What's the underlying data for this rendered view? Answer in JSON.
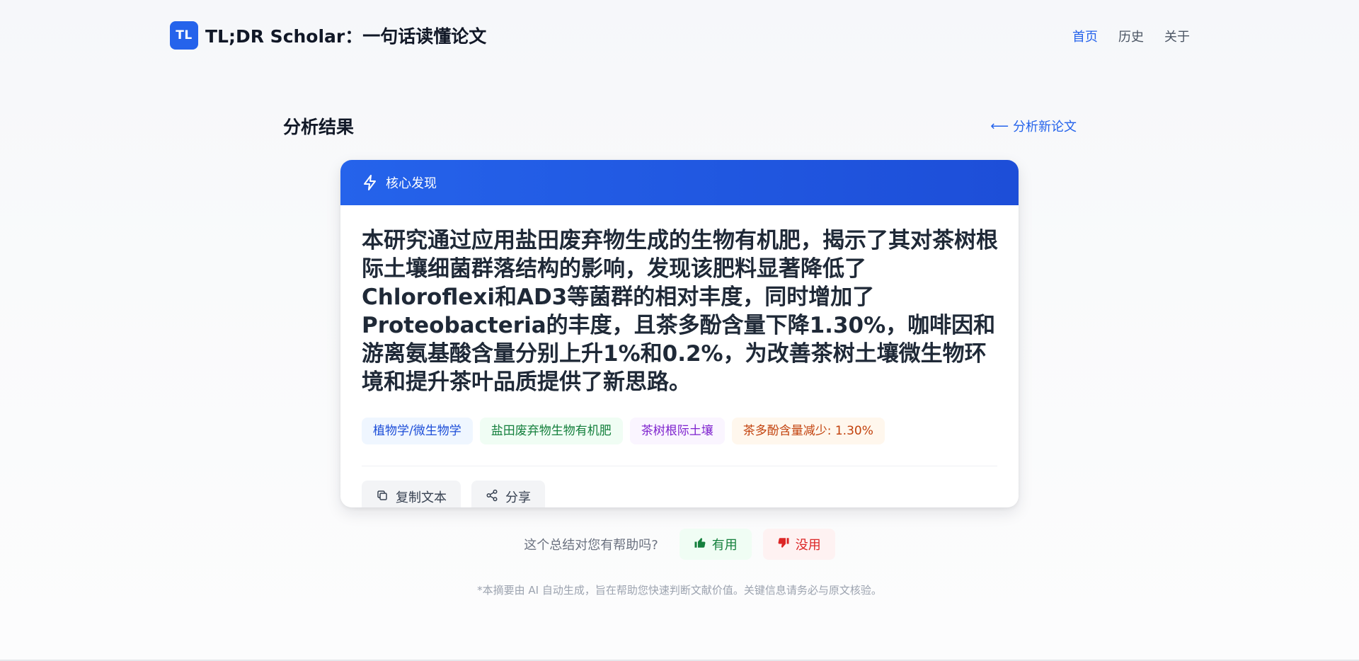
{
  "header": {
    "logo_badge": "TL",
    "title": "TL;DR Scholar：一句话读懂论文",
    "nav": [
      "首页",
      "历史",
      "关于"
    ]
  },
  "section": {
    "title": "分析结果",
    "back_label": "分析新论文"
  },
  "card": {
    "header_label": "核心发现",
    "summary": "本研究通过应用盐田废弃物生成的生物有机肥，揭示了其对茶树根际土壤细菌群落结构的影响，发现该肥料显著降低了Chloroflexi和AD3等菌群的相对丰度，同时增加了Proteobacteria的丰度，且茶多酚含量下降1.30%，咖啡因和游离氨基酸含量分别上升1%和0.2%，为改善茶树土壤微生物环境和提升茶叶品质提供了新思路。",
    "tags": [
      {
        "label": "植物学/微生物学",
        "color": "blue"
      },
      {
        "label": "盐田废弃物生物有机肥",
        "color": "green"
      },
      {
        "label": "茶树根际土壤",
        "color": "purple"
      },
      {
        "label": "茶多酚含量减少: 1.30%",
        "color": "orange"
      }
    ],
    "actions": {
      "copy_label": "复制文本",
      "share_label": "分享"
    }
  },
  "feedback": {
    "question": "这个总结对您有帮助吗?",
    "yes_label": "有用",
    "no_label": "没用"
  },
  "disclaimer": "*本摘要由 AI 自动生成，旨在帮助您快速判断文献价值。关键信息请务必与原文核验。",
  "colors": {
    "accent": "#2563eb",
    "tag_blue": "#1d4ed8",
    "tag_green": "#15803d",
    "tag_purple": "#7e22ce",
    "tag_orange": "#c2410c",
    "useful": "#15803d",
    "useless": "#dc2626"
  }
}
